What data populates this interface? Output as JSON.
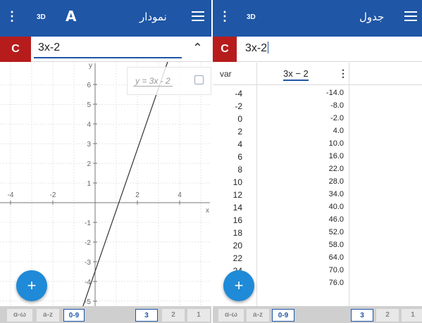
{
  "graph_view": {
    "title": "نمودار",
    "label_3d": "3D",
    "expression": "3x-2",
    "input_prefix": "C",
    "legend_label": "y = 3x - 2",
    "fab_label": "+",
    "x_ticks": [
      "-4",
      "-2",
      "2",
      "4"
    ],
    "x_axis_label": "x",
    "y_axis_label": "y",
    "y_ticks": [
      "6",
      "5",
      "4",
      "3",
      "2",
      "1",
      "-1",
      "-2",
      "-3",
      "-4",
      "-5"
    ],
    "keyboard_tabs": [
      "α-ω",
      "a-z",
      "0-9"
    ],
    "keyboard_nums": [
      "3",
      "2",
      "1"
    ]
  },
  "table_view": {
    "title": "جدول",
    "label_3d": "3D",
    "expression": "3x-2",
    "input_prefix": "C",
    "col_var_header": "var",
    "col_expr_header": "3x − 2",
    "fab_label": "+",
    "rows": [
      {
        "x": "-4",
        "y": "-14.0"
      },
      {
        "x": "-2",
        "y": "-8.0"
      },
      {
        "x": "0",
        "y": "-2.0"
      },
      {
        "x": "2",
        "y": "4.0"
      },
      {
        "x": "4",
        "y": "10.0"
      },
      {
        "x": "6",
        "y": "16.0"
      },
      {
        "x": "8",
        "y": "22.0"
      },
      {
        "x": "10",
        "y": "28.0"
      },
      {
        "x": "12",
        "y": "34.0"
      },
      {
        "x": "14",
        "y": "40.0"
      },
      {
        "x": "16",
        "y": "46.0"
      },
      {
        "x": "18",
        "y": "52.0"
      },
      {
        "x": "20",
        "y": "58.0"
      },
      {
        "x": "22",
        "y": "64.0"
      },
      {
        "x": "24",
        "y": "70.0"
      },
      {
        "x": "",
        "y": "76.0"
      }
    ],
    "keyboard_tabs": [
      "α-ω",
      "a-z",
      "0-9"
    ],
    "keyboard_nums": [
      "3",
      "2",
      "1"
    ]
  },
  "colors": {
    "appbar": "#1f56a6",
    "c_box": "#b71c1c",
    "fab": "#1f8ad8"
  },
  "icons": {
    "menu": "hamburger-icon",
    "more": "vertical-dots-icon",
    "tool": "text-tool-icon",
    "collapse": "chevron-up-icon"
  }
}
